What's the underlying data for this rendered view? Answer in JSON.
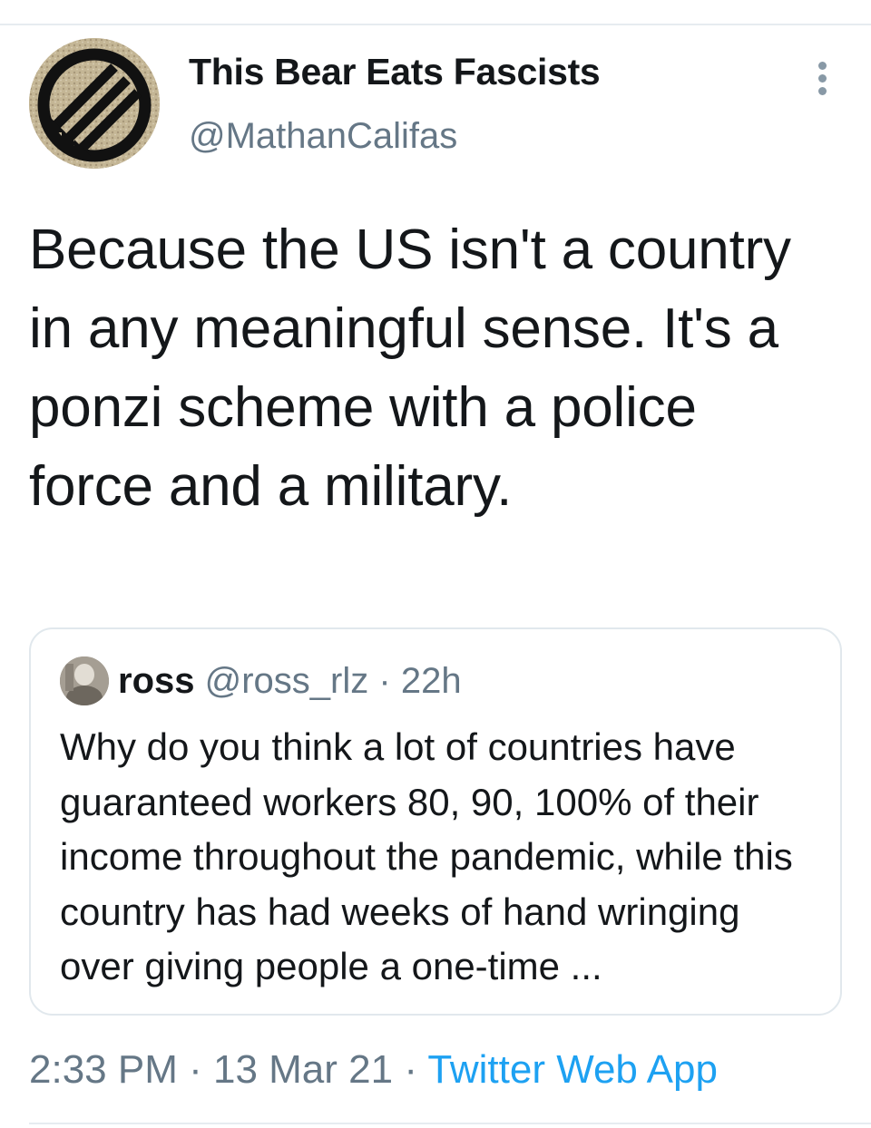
{
  "author": {
    "display_name": "This Bear Eats Fascists",
    "handle": "@MathanCalifas"
  },
  "tweet": {
    "text": "Because the US isn't a country in any meaningful sense. It's a ponzi scheme with a police force and a military."
  },
  "quoted_tweet": {
    "name": "ross",
    "handle": "@ross_rlz",
    "separator": "·",
    "time": "22h",
    "text": "Why do you think a lot of countries have guaranteed workers 80, 90, 100% of their income throughout the pandemic, while this country has had weeks of hand wringing over giving people a one-time ..."
  },
  "meta": {
    "time": "2:33 PM",
    "separator": " · ",
    "date": "13 Mar 21",
    "source": "Twitter Web App"
  },
  "colors": {
    "text_primary": "#14171a",
    "text_secondary": "#657786",
    "link": "#1da1f2",
    "border": "#e1e8ed"
  },
  "icons": {
    "avatar_emblem": "iron-front-three-arrows-icon",
    "more": "more-vertical-icon"
  }
}
